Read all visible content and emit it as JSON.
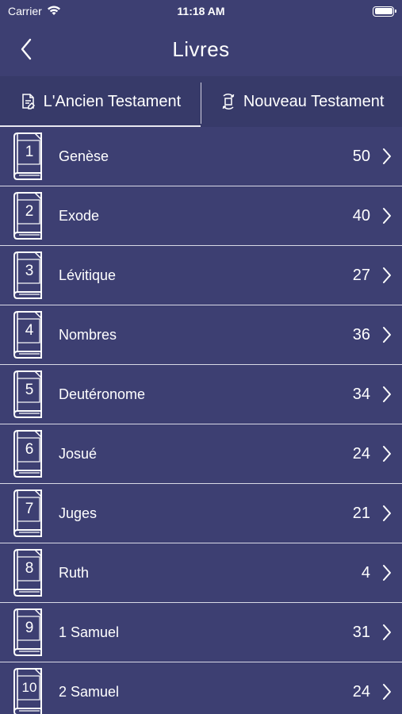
{
  "status_bar": {
    "carrier": "Carrier",
    "time": "11:18 AM"
  },
  "nav": {
    "title": "Livres",
    "back_icon": "chevron-left-icon"
  },
  "tabs": [
    {
      "label": "L'Ancien Testament",
      "icon": "old-testament-icon",
      "active": true
    },
    {
      "label": "Nouveau Testament",
      "icon": "new-testament-icon",
      "active": false
    }
  ],
  "books": [
    {
      "number": "1",
      "name": "Genèse",
      "chapters": "50"
    },
    {
      "number": "2",
      "name": "Exode",
      "chapters": "40"
    },
    {
      "number": "3",
      "name": "Lévitique",
      "chapters": "27"
    },
    {
      "number": "4",
      "name": "Nombres",
      "chapters": "36"
    },
    {
      "number": "5",
      "name": "Deutéronome",
      "chapters": "34"
    },
    {
      "number": "6",
      "name": "Josué",
      "chapters": "24"
    },
    {
      "number": "7",
      "name": "Juges",
      "chapters": "21"
    },
    {
      "number": "8",
      "name": "Ruth",
      "chapters": "4"
    },
    {
      "number": "9",
      "name": "1 Samuel",
      "chapters": "31"
    },
    {
      "number": "10",
      "name": "2 Samuel",
      "chapters": "24"
    }
  ],
  "colors": {
    "background": "#3d3f72",
    "tab_background": "#373a69",
    "text": "#ffffff",
    "divider": "#d8d9e6"
  }
}
